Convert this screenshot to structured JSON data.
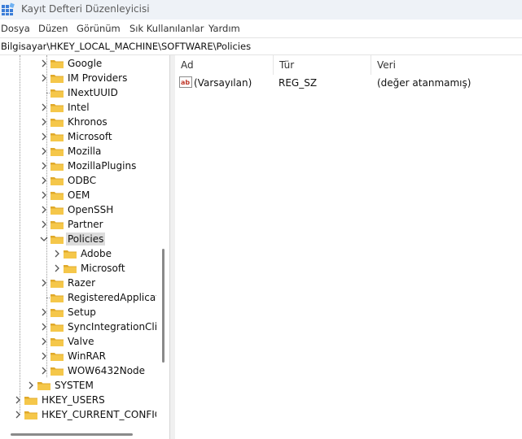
{
  "window": {
    "title": "Kayıt Defteri Düzenleyicisi"
  },
  "menu": [
    "Dosya",
    "Düzen",
    "Görünüm",
    "Sık Kullanılanlar",
    "Yardım"
  ],
  "address": "Bilgisayar\\HKEY_LOCAL_MACHINE\\SOFTWARE\\Policies",
  "tree": {
    "items": [
      {
        "label": "Google",
        "expand": "collapsed"
      },
      {
        "label": "IM Providers",
        "expand": "collapsed"
      },
      {
        "label": "INextUUID",
        "expand": "none"
      },
      {
        "label": "Intel",
        "expand": "collapsed"
      },
      {
        "label": "Khronos",
        "expand": "collapsed"
      },
      {
        "label": "Microsoft",
        "expand": "collapsed"
      },
      {
        "label": "Mozilla",
        "expand": "collapsed"
      },
      {
        "label": "MozillaPlugins",
        "expand": "collapsed"
      },
      {
        "label": "ODBC",
        "expand": "collapsed"
      },
      {
        "label": "OEM",
        "expand": "collapsed"
      },
      {
        "label": "OpenSSH",
        "expand": "collapsed"
      },
      {
        "label": "Partner",
        "expand": "collapsed"
      },
      {
        "label": "Policies",
        "expand": "expanded",
        "selected": true
      },
      {
        "label": "Adobe",
        "expand": "collapsed",
        "child": true
      },
      {
        "label": "Microsoft",
        "expand": "collapsed",
        "child": true
      },
      {
        "label": "Razer",
        "expand": "collapsed"
      },
      {
        "label": "RegisteredApplications",
        "expand": "none"
      },
      {
        "label": "Setup",
        "expand": "collapsed"
      },
      {
        "label": "SyncIntegrationClients",
        "expand": "collapsed"
      },
      {
        "label": "Valve",
        "expand": "collapsed"
      },
      {
        "label": "WinRAR",
        "expand": "collapsed"
      },
      {
        "label": "WOW6432Node",
        "expand": "collapsed"
      },
      {
        "label": "SYSTEM",
        "expand": "collapsed",
        "level": "hive-child"
      },
      {
        "label": "HKEY_USERS",
        "expand": "collapsed",
        "level": "root"
      },
      {
        "label": "HKEY_CURRENT_CONFIG",
        "expand": "collapsed",
        "level": "root"
      }
    ]
  },
  "list": {
    "columns": [
      "Ad",
      "Tür",
      "Veri"
    ],
    "rows": [
      {
        "name": "(Varsayılan)",
        "type": "REG_SZ",
        "data": "(değer atanmamış)",
        "icon": "string-value-icon"
      }
    ]
  },
  "colors": {
    "folder": "#f5c74a",
    "folder_dark": "#e0a92a",
    "selection": "#dcdcdc",
    "ab_icon": "#c0392b"
  }
}
